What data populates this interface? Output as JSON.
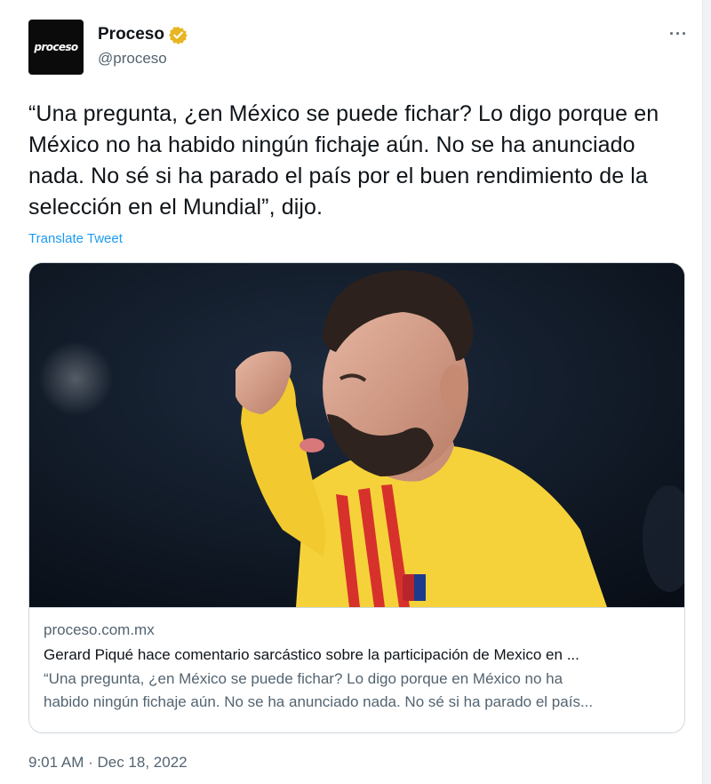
{
  "account": {
    "avatar_text": "proceso",
    "display_name": "Proceso",
    "handle": "@proceso",
    "verified_color": "#e8b624"
  },
  "menu": {
    "more_label": "···"
  },
  "tweet": {
    "text": "“Una pregunta, ¿en México se puede fichar? Lo digo porque en México no ha habido ningún fichaje aún. No se ha anunciado nada. No sé si ha parado el país por el buen rendimiento de la selección en el Mundial”, dijo.",
    "translate_label": "Translate Tweet",
    "timestamp": "9:01 AM · Dec 18, 2022"
  },
  "card": {
    "domain": "proceso.com.mx",
    "title": "Gerard Piqué hace comentario sarcástico sobre la participación de Mexico en ...",
    "description_line1": "“Una pregunta, ¿en México se puede fichar? Lo digo porque en México no ha",
    "description_line2": "habido ningún fichaje aún. No se ha anunciado nada. No sé si ha parado el país..."
  },
  "colors": {
    "link": "#1d9bf0",
    "secondary_text": "#536471",
    "jersey_yellow": "#f5d23a",
    "stripe_red": "#d7312b"
  }
}
